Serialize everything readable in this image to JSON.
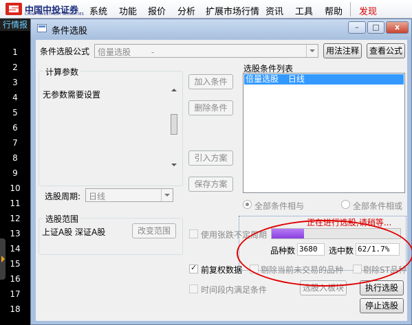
{
  "menubar": {
    "logo_cn": "中国中投证券",
    "logo_en": "CHINA INVESTMENT SECURITIES",
    "items": [
      "系统",
      "功能",
      "报价",
      "分析",
      "扩展市场行情",
      "资讯",
      "工具",
      "帮助",
      "发现"
    ]
  },
  "sidebar": {
    "tab": "行情报",
    "rows": [
      "1",
      "2",
      "3",
      "4",
      "5",
      "6",
      "7",
      "8",
      "9",
      "10",
      "11",
      "12",
      "13",
      "14",
      "15",
      "16",
      "17",
      "18"
    ]
  },
  "dialog": {
    "title": "条件选股",
    "window_buttons": {
      "minimize": "–",
      "maximize": "□",
      "close": "x"
    },
    "formula_label": "条件选股公式",
    "formula_value": "倍量选股",
    "formula_value_suffix": "-",
    "usage_button": "用法注释",
    "view_formula_button": "查看公式",
    "params_group_title": "计算参数",
    "params_text": "无参数需要设置",
    "period_label": "选股周期:",
    "period_value": "日线",
    "add_condition": "加入条件",
    "delete_condition": "删除条件",
    "import_plan": "引入方案",
    "save_plan": "保存方案",
    "conditions_list_title": "选股条件列表",
    "conditions": [
      {
        "name": "倍量选股",
        "period": "日线"
      }
    ],
    "radio_and": "全部条件相与",
    "radio_or": "全部条件相或",
    "range_group_title": "选股范围",
    "range_text": "上证A股 深证A股",
    "change_range": "改变范围",
    "use_period_label": "使用张跌不定周期",
    "status_text": "正在进行选股,请稍等...",
    "progress": 0.25,
    "count_label": "品种数",
    "count_value": "3680",
    "selected_label": "选中数",
    "selected_value": "62/1.7%",
    "fq_label": "前复权数据",
    "exclude_label": "剔除当前未交易的品种",
    "exclude_st_label": "剔除ST品种",
    "time_range_label": "时间段内满足条件",
    "to_block_button": "选股入板块",
    "run_button": "执行选股",
    "stop_button": "停止选股"
  },
  "colors": {
    "annotation": "#e00000",
    "progress": "#8a3fe0",
    "selection": "#3399ff",
    "status": "#d40000"
  }
}
